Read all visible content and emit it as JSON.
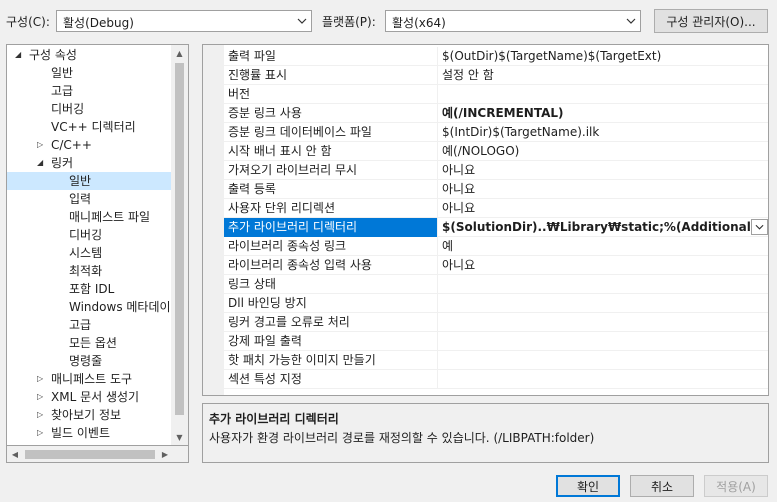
{
  "toolbar": {
    "config_label": "구성(C):",
    "config_value": "활성(Debug)",
    "platform_label": "플랫폼(P):",
    "platform_value": "활성(x64)",
    "config_manager_label": "구성 관리자(O)..."
  },
  "tree": {
    "items": [
      {
        "label": "구성 속성",
        "state": "expanded"
      },
      {
        "label": "일반"
      },
      {
        "label": "고급"
      },
      {
        "label": "디버깅"
      },
      {
        "label": "VC++ 디렉터리"
      },
      {
        "label": "C/C++",
        "state": "collapsed"
      },
      {
        "label": "링커",
        "state": "expanded"
      },
      {
        "label": "일반",
        "selected": true
      },
      {
        "label": "입력"
      },
      {
        "label": "매니페스트 파일"
      },
      {
        "label": "디버깅"
      },
      {
        "label": "시스템"
      },
      {
        "label": "최적화"
      },
      {
        "label": "포함 IDL"
      },
      {
        "label": "Windows 메타데이터"
      },
      {
        "label": "고급"
      },
      {
        "label": "모든 옵션"
      },
      {
        "label": "명령줄"
      },
      {
        "label": "매니페스트 도구",
        "state": "collapsed"
      },
      {
        "label": "XML 문서 생성기",
        "state": "collapsed"
      },
      {
        "label": "찾아보기 정보",
        "state": "collapsed"
      },
      {
        "label": "빌드 이벤트",
        "state": "collapsed"
      }
    ]
  },
  "grid": {
    "rows": [
      {
        "name": "출력 파일",
        "value": "$(OutDir)$(TargetName)$(TargetExt)"
      },
      {
        "name": "진행률 표시",
        "value": "설정 안 함"
      },
      {
        "name": "버전",
        "value": ""
      },
      {
        "name": "증분 링크 사용",
        "value": "예(/INCREMENTAL)",
        "bold": true
      },
      {
        "name": "증분 링크 데이터베이스 파일",
        "value": "$(IntDir)$(TargetName).ilk"
      },
      {
        "name": "시작 배너 표시 안 함",
        "value": "예(/NOLOGO)"
      },
      {
        "name": "가져오기 라이브러리 무시",
        "value": "아니요"
      },
      {
        "name": "출력 등록",
        "value": "아니요"
      },
      {
        "name": "사용자 단위 리디렉션",
        "value": "아니요"
      },
      {
        "name": "추가 라이브러리 디렉터리",
        "value": "$(SolutionDir)..₩Library₩static;%(AdditionalLibraryDir",
        "bold": true,
        "selected": true
      },
      {
        "name": "라이브러리 종속성 링크",
        "value": "예"
      },
      {
        "name": "라이브러리 종속성 입력 사용",
        "value": "아니요"
      },
      {
        "name": "링크 상태",
        "value": ""
      },
      {
        "name": "Dll 바인딩 방지",
        "value": ""
      },
      {
        "name": "링커 경고를 오류로 처리",
        "value": ""
      },
      {
        "name": "강제 파일 출력",
        "value": ""
      },
      {
        "name": "핫 패치 가능한 이미지 만들기",
        "value": ""
      },
      {
        "name": "섹션 특성 지정",
        "value": ""
      }
    ]
  },
  "description": {
    "title": "추가 라이브러리 디렉터리",
    "text": "사용자가 환경 라이브러리 경로를 재정의할 수 있습니다. (/LIBPATH:folder)"
  },
  "buttons": {
    "ok": "확인",
    "cancel": "취소",
    "apply": "적용(A)"
  },
  "colors": {
    "selection": "#0078d7",
    "tree_selection": "#cce8ff",
    "background": "#f0f0f0"
  }
}
